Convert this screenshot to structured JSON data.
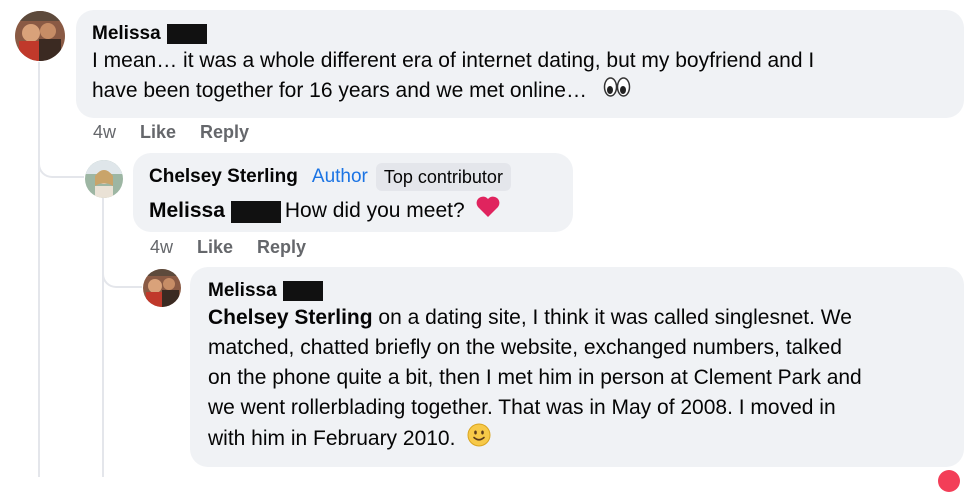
{
  "comments": [
    {
      "author": "Melissa",
      "lines": [
        "I mean… it was a whole different era of internet dating, but my boyfriend and I",
        "have been together for 16 years and we met online…"
      ],
      "emoji": "eyes-emoji",
      "time": "4w",
      "like_label": "Like",
      "reply_label": "Reply"
    },
    {
      "author": "Chelsey Sterling",
      "author_badge": "Author",
      "contributor_badge": "Top contributor",
      "mention": "Melissa",
      "text": "How did you meet?",
      "emoji": "red-heart-emoji",
      "time": "4w",
      "like_label": "Like",
      "reply_label": "Reply"
    },
    {
      "author": "Melissa",
      "mention": "Chelsey Sterling",
      "first_line_rest": " on a dating site, I think it was called singlesnet. We",
      "lines": [
        "matched, chatted briefly on the website, exchanged numbers, talked",
        "on the phone quite a bit, then I met him in person at Clement Park and",
        "we went rollerblading together. That was in May of 2008. I moved in",
        "with him in February 2010."
      ],
      "emoji": "slightly-smiling-emoji"
    }
  ]
}
